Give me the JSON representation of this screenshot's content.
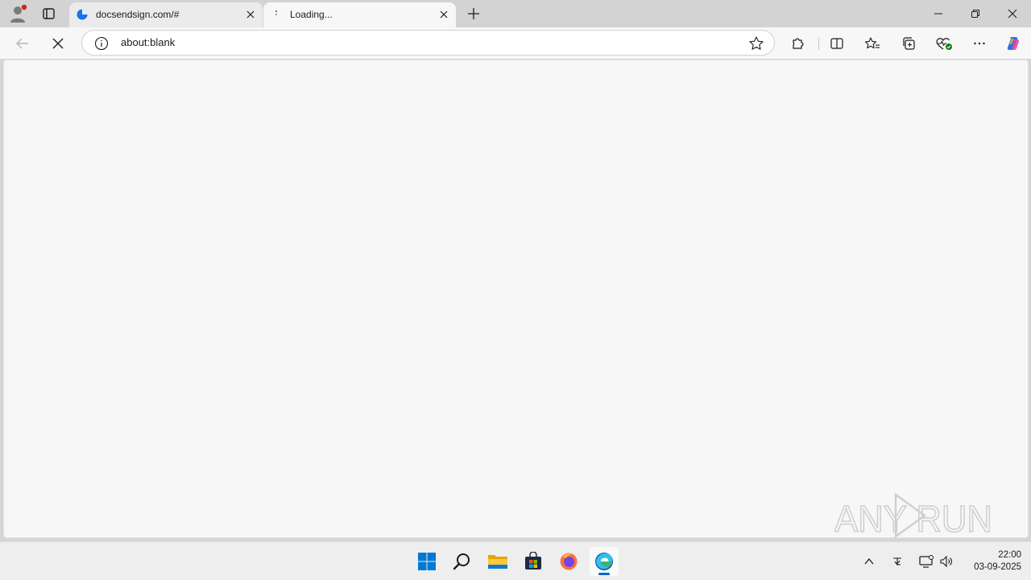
{
  "browser": {
    "tabs": [
      {
        "title": "docsendsign.com/#",
        "active": false
      },
      {
        "title": "Loading...",
        "active": true
      }
    ],
    "address_bar": {
      "url": "about:blank"
    },
    "accent_color": "#0067c0"
  },
  "watermark": {
    "text": "ANY RUN"
  },
  "taskbar": {
    "items": [
      "start-icon",
      "search-icon",
      "file-explorer-icon",
      "store-icon",
      "firefox-icon",
      "edge-icon"
    ],
    "clock": {
      "time": "22:00",
      "date": "03-09-2025"
    }
  }
}
